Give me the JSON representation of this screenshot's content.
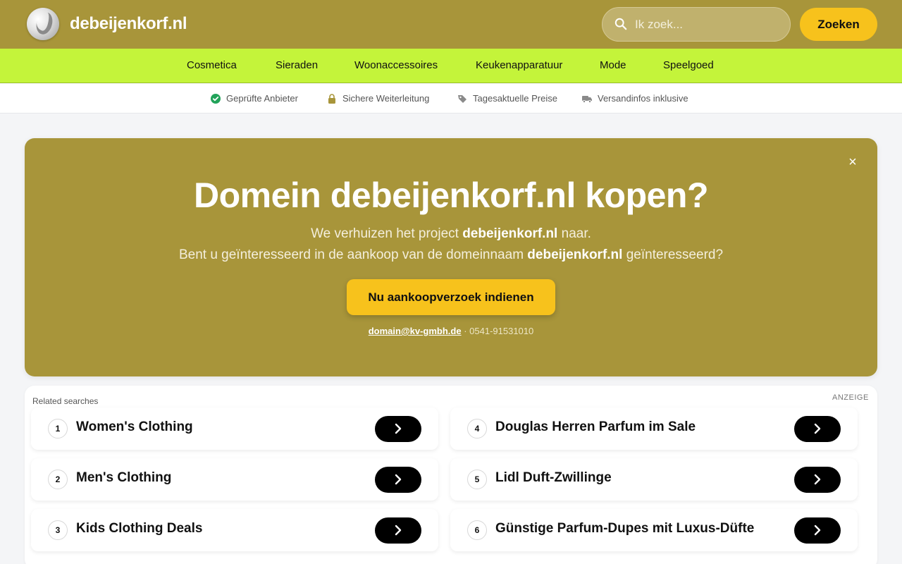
{
  "header": {
    "site_name": "debeijenkorf.nl",
    "search_placeholder": "Ik zoek...",
    "search_button": "Zoeken"
  },
  "categories": [
    "Cosmetica",
    "Sieraden",
    "Woonaccessoires",
    "Keukenapparatuur",
    "Mode",
    "Speelgoed"
  ],
  "trust": [
    {
      "label": "Geprüfte Anbieter",
      "icon": "check-circle-icon"
    },
    {
      "label": "Sichere Weiterleitung",
      "icon": "lock-icon"
    },
    {
      "label": "Tagesaktuelle Preise",
      "icon": "tag-icon"
    },
    {
      "label": "Versandinfos inklusive",
      "icon": "truck-icon"
    }
  ],
  "hero": {
    "close": "×",
    "title": "Domein debeijenkorf.nl kopen?",
    "line1_pre": "We verhuizen het project ",
    "line1_bold": "debeijenkorf.nl",
    "line1_post": " naar.",
    "line2_pre": "Bent u geïnteresseerd in de aankoop van de domeinnaam ",
    "line2_bold": "debeijenkorf.nl",
    "line2_post": " geïnteresseerd?",
    "cta": "Nu aankoopverzoek indienen",
    "email": "domain@kv-gmbh.de",
    "separator": " · ",
    "phone": "0541-91531010"
  },
  "related": {
    "title": "Related searches",
    "ad_label": "ANZEIGE",
    "items": [
      {
        "num": "1",
        "label": "Women's Clothing"
      },
      {
        "num": "2",
        "label": "Men's Clothing"
      },
      {
        "num": "3",
        "label": "Kids Clothing Deals"
      },
      {
        "num": "4",
        "label": "Douglas Herren Parfum im Sale"
      },
      {
        "num": "5",
        "label": "Lidl Duft-Zwillinge"
      },
      {
        "num": "6",
        "label": "Günstige Parfum-Dupes mit Luxus-Düfte"
      }
    ]
  },
  "colors": {
    "header_bg": "#a8953a",
    "nav_bg": "#c4f43a",
    "accent_button": "#f7c21c",
    "check_green": "#22a35a"
  }
}
